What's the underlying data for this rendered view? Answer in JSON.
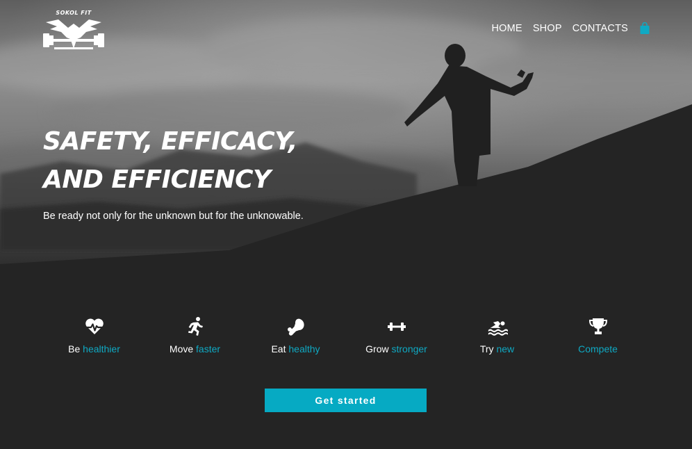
{
  "brand": {
    "name": "SOKOL FIT"
  },
  "nav": {
    "items": [
      "HOME",
      "SHOP",
      "CONTACTS"
    ],
    "cart_icon": "shopping-bag-icon"
  },
  "hero": {
    "headline_line1": "SAFETY, EFFICACY,",
    "headline_line2": "AND EFFICIENCY",
    "subtitle": "Be ready not only for the unknown but for the unknowable."
  },
  "features": [
    {
      "icon": "heart-pulse-icon",
      "prefix": "Be",
      "accent": "healthier"
    },
    {
      "icon": "running-icon",
      "prefix": "Move",
      "accent": "faster"
    },
    {
      "icon": "drumstick-icon",
      "prefix": "Eat",
      "accent": "healthy"
    },
    {
      "icon": "dumbbell-icon",
      "prefix": "Grow",
      "accent": "stronger"
    },
    {
      "icon": "swimming-icon",
      "prefix": "Try",
      "accent": "new"
    },
    {
      "icon": "trophy-icon",
      "prefix": "",
      "accent": "Compete"
    }
  ],
  "cta": {
    "label": "Get started"
  },
  "colors": {
    "accent": "#0fa9c3",
    "button": "#06aac3",
    "background": "#232323"
  }
}
